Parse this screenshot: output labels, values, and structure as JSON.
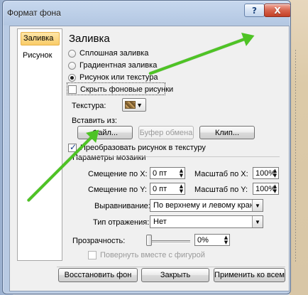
{
  "window": {
    "title": "Формат фона",
    "help_label": "?",
    "close_label": "X"
  },
  "sidebar": {
    "items": [
      {
        "label": "Заливка",
        "selected": true
      },
      {
        "label": "Рисунок",
        "selected": false
      }
    ]
  },
  "fill": {
    "heading": "Заливка",
    "options": [
      {
        "label": "Сплошная заливка",
        "checked": false
      },
      {
        "label": "Градиентная заливка",
        "checked": false
      },
      {
        "label": "Рисунок или текстура",
        "checked": true
      }
    ],
    "hide_background": {
      "label": "Скрыть фоновые рисунки",
      "checked": false
    },
    "texture_label": "Текстура:",
    "insert_from_label": "Вставить из:",
    "buttons": {
      "file": "Файл...",
      "clipboard": "Буфер обмена",
      "clip": "Клип..."
    },
    "tile_checkbox": {
      "label": "Преобразовать рисунок в текстуру",
      "checked": true
    },
    "tiling_group_label": "Параметры мозаики",
    "offset_x_label": "Смещение по X:",
    "offset_x_value": "0 пт",
    "scale_x_label": "Масштаб по X:",
    "scale_x_value": "100%",
    "offset_y_label": "Смещение по Y:",
    "offset_y_value": "0 пт",
    "scale_y_label": "Масштаб по Y:",
    "scale_y_value": "100%",
    "alignment_label": "Выравнивание:",
    "alignment_value": "По верхнему и левому краю",
    "mirror_label": "Тип отражения:",
    "mirror_value": "Нет",
    "transparency_label": "Прозрачность:",
    "transparency_value": "0%",
    "transparency_level": 0,
    "rotate_with_shape": {
      "label": "Повернуть вместе с фигурой",
      "checked": false
    }
  },
  "footer": {
    "reset": "Восстановить фон",
    "close": "Закрыть",
    "apply_all": "Применить ко всем"
  },
  "colors": {
    "annotation_arrow": "#4ec325",
    "selected_nav": "#f9cc68",
    "window_frame": "#b8cae3"
  },
  "icons": {
    "help": "question-mark",
    "close": "close",
    "texture": "wood-texture",
    "dropdown": "chevron-down",
    "spinner_up": "chevron-up",
    "spinner_down": "chevron-down"
  }
}
